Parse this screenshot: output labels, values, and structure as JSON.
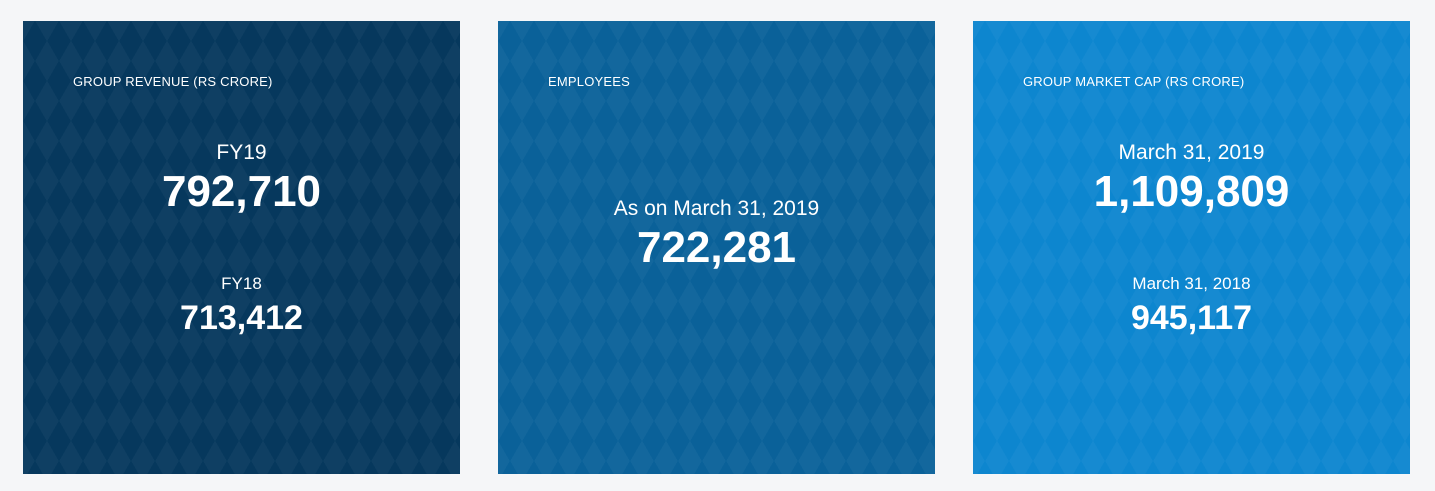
{
  "colors": {
    "page_background": "#f5f6f8",
    "card_revenue": "#06385d",
    "card_employees": "#0a6199",
    "card_market_cap": "#0d86cf",
    "text": "#ffffff"
  },
  "cards": [
    {
      "label": "GROUP REVENUE (RS CRORE)",
      "primary": {
        "caption": "FY19",
        "value": "792,710"
      },
      "secondary": {
        "caption": "FY18",
        "value": "713,412"
      }
    },
    {
      "label": "EMPLOYEES",
      "primary": {
        "caption": "As on March 31, 2019",
        "value": "722,281"
      }
    },
    {
      "label": "GROUP MARKET CAP (RS CRORE)",
      "primary": {
        "caption": "March 31, 2019",
        "value": "1,109,809"
      },
      "secondary": {
        "caption": "March 31, 2018",
        "value": "945,117"
      }
    }
  ]
}
